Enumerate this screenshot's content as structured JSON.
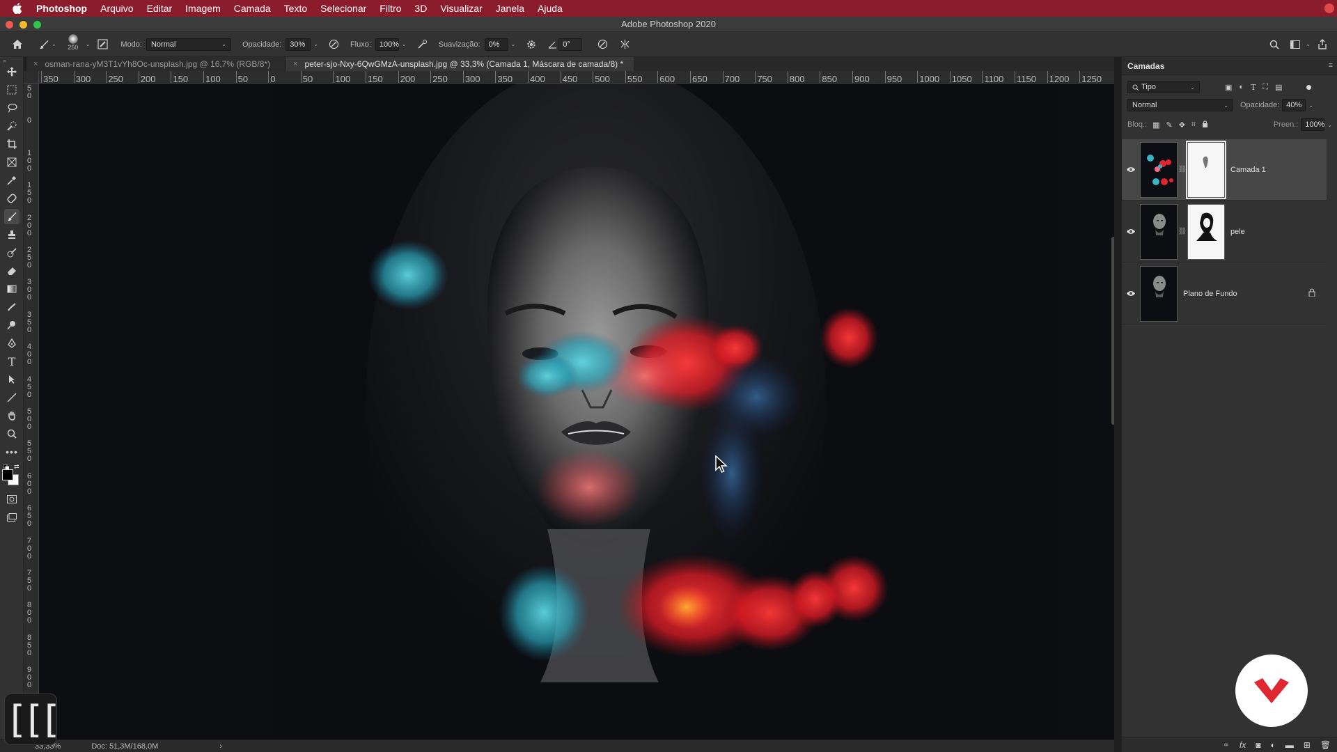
{
  "menubar": {
    "app": "Photoshop",
    "items": [
      "Arquivo",
      "Editar",
      "Imagem",
      "Camada",
      "Texto",
      "Selecionar",
      "Filtro",
      "3D",
      "Visualizar",
      "Janela",
      "Ajuda"
    ],
    "bg_color": "#8a1c2c"
  },
  "window": {
    "title": "Adobe Photoshop 2020"
  },
  "options_bar": {
    "brush_size": "250",
    "mode_label": "Modo:",
    "mode_value": "Normal",
    "opacity_label": "Opacidade:",
    "opacity_value": "30%",
    "flow_label": "Fluxo:",
    "flow_value": "100%",
    "smoothing_label": "Suavização:",
    "smoothing_value": "0%",
    "angle_value": "0°"
  },
  "tabs": [
    {
      "close": "×",
      "label": "osman-rana-yM3T1vYh8Oc-unsplash.jpg @ 16,7% (RGB/8*)",
      "active": false
    },
    {
      "close": "×",
      "label": "peter-sjo-Nxy-6QwGMzA-unsplash.jpg @ 33,3% (Camada 1, Máscara de camada/8) *",
      "active": true
    }
  ],
  "ruler": {
    "horizontal": [
      "350",
      "300",
      "250",
      "200",
      "150",
      "100",
      "50",
      "0",
      "50",
      "100",
      "150",
      "200",
      "250",
      "300",
      "350",
      "400",
      "450",
      "500",
      "550",
      "600",
      "650",
      "700",
      "750",
      "800",
      "850",
      "900",
      "950",
      "1000",
      "1050",
      "1100",
      "1150",
      "1200",
      "1250"
    ],
    "vertical": [
      "50",
      "0",
      "100",
      "150",
      "200",
      "250",
      "300",
      "350",
      "400",
      "450",
      "500",
      "550",
      "600",
      "650",
      "700",
      "750",
      "800",
      "850",
      "900",
      "950"
    ]
  },
  "status": {
    "zoom": "33,33%",
    "doc": "Doc: 51,3M/168,0M",
    "arrow": "›"
  },
  "layers_panel": {
    "title": "Camadas",
    "filter_label": "Tipo",
    "blend_mode": "Normal",
    "opacity_label": "Opacidade:",
    "opacity_value": "40%",
    "lock_label": "Bloq.:",
    "fill_label": "Preen.:",
    "fill_value": "100%",
    "layers": [
      {
        "name": "Camada 1",
        "selected": true,
        "has_mask": true
      },
      {
        "name": "pele",
        "selected": false,
        "has_mask": true
      },
      {
        "name": "Plano de Fundo",
        "selected": false,
        "has_mask": false,
        "locked": true
      }
    ]
  },
  "colors": {
    "accent_red": "#e0262f",
    "cyan_paint": "#38b8c8",
    "panel_bg": "#323232",
    "canvas_bg": "#0c0e12"
  },
  "icons": [
    "apple-icon",
    "home-icon",
    "brush-tool-icon",
    "move-tool-icon",
    "marquee-tool-icon",
    "lasso-tool-icon",
    "crop-tool-icon",
    "eyedropper-icon",
    "healing-brush-icon",
    "stamp-icon",
    "eraser-icon",
    "gradient-icon",
    "dodge-icon",
    "pen-tool-icon",
    "type-tool-icon",
    "path-selection-icon",
    "hand-tool-icon",
    "zoom-tool-icon",
    "eye-icon",
    "chain-link-icon",
    "lock-icon",
    "search-icon",
    "share-icon",
    "trash-icon"
  ]
}
